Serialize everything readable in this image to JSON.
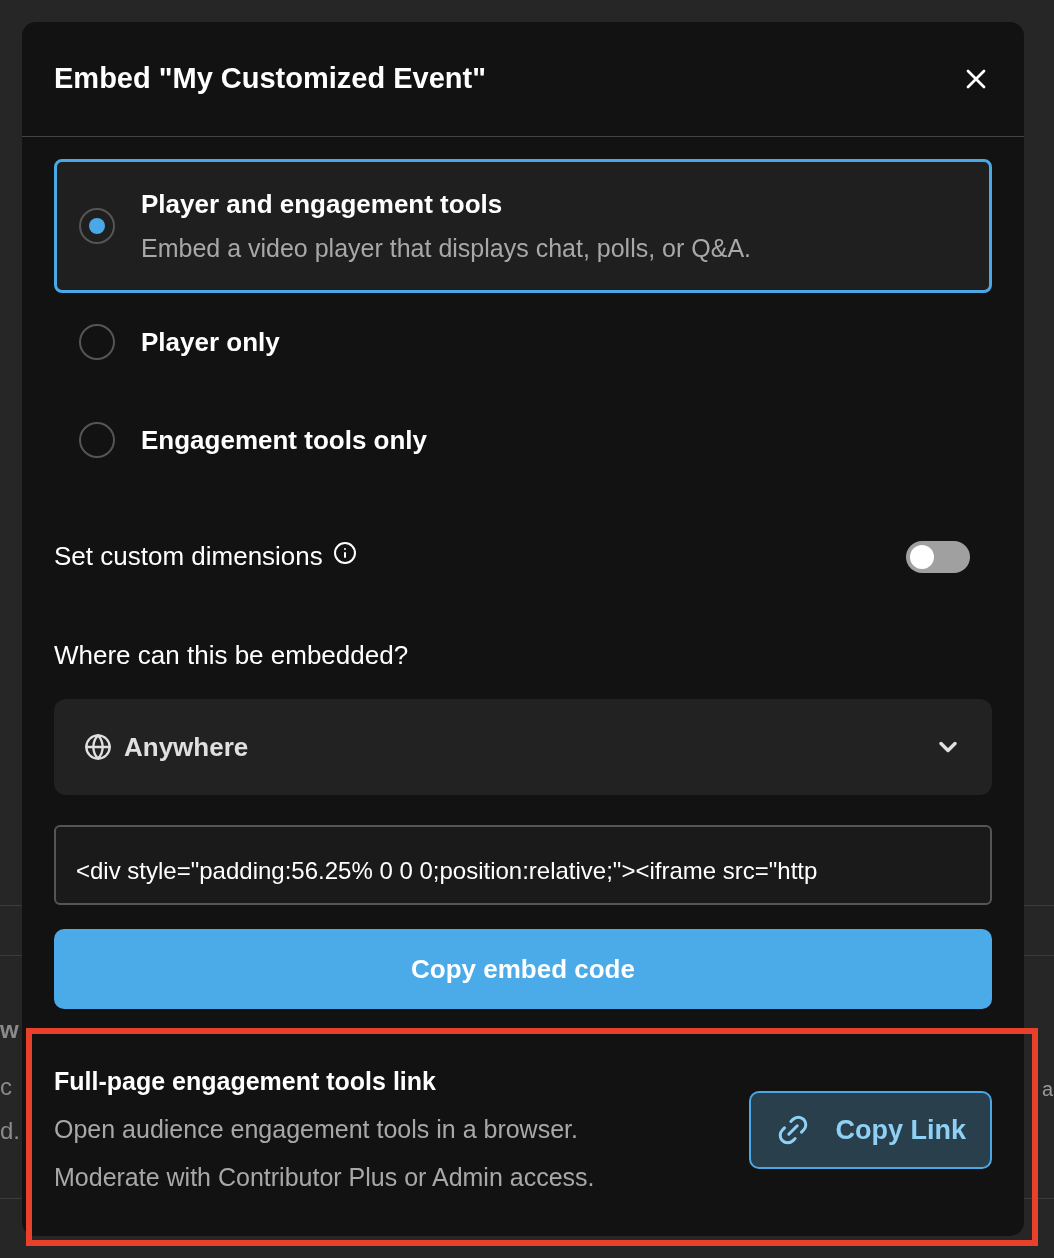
{
  "background": {
    "heading_fragment": "w",
    "left_fragments": [
      "c",
      "d."
    ],
    "right_fragments": [
      "a"
    ]
  },
  "dialog": {
    "title": "Embed \"My Customized Event\"",
    "options": [
      {
        "label": "Player and engagement tools",
        "description": "Embed a video player that displays chat, polls, or Q&A.",
        "selected": true
      },
      {
        "label": "Player only",
        "selected": false
      },
      {
        "label": "Engagement tools only",
        "selected": false
      }
    ],
    "custom_dimensions": {
      "label": "Set custom dimensions",
      "on": false
    },
    "embed_location": {
      "label": "Where can this be embedded?",
      "value": "Anywhere"
    },
    "embed_code": "<div style=\"padding:56.25% 0 0 0;position:relative;\"><iframe src=\"http",
    "copy_button": "Copy embed code",
    "link_section": {
      "title": "Full-page engagement tools link",
      "lines": [
        "Open audience engagement tools in a browser.",
        "Moderate with Contributor Plus or Admin access."
      ],
      "button": "Copy Link",
      "highlighted": true
    }
  }
}
